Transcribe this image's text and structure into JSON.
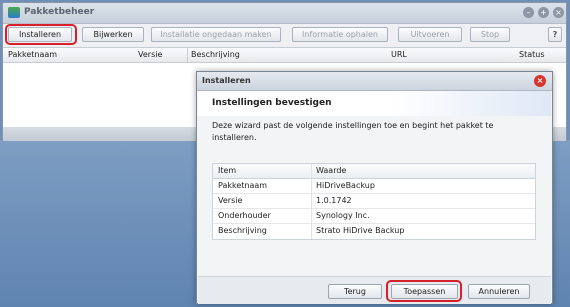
{
  "window": {
    "title": "Pakketbeheer",
    "controls": [
      "minimize-icon",
      "maximize-icon",
      "close-icon"
    ]
  },
  "toolbar": {
    "install_label": "Installeren",
    "update_label": "Bijwerken",
    "undo_install_label": "Installatie ongedaan maken",
    "info_label": "Informatie ophalen",
    "run_label": "Uitvoeren",
    "stop_label": "Stop",
    "help_label": "?"
  },
  "grid": {
    "columns": [
      "Pakketnaam",
      "Versie",
      "Beschrijving",
      "URL",
      "Status"
    ]
  },
  "dialog": {
    "title": "Installeren",
    "heading": "Instellingen bevestigen",
    "description": "Deze wizard past de volgende instellingen toe en begint het pakket te installeren.",
    "table": {
      "headers": [
        "Item",
        "Waarde"
      ],
      "rows": [
        [
          "Pakketnaam",
          "HiDriveBackup"
        ],
        [
          "Versie",
          "1.0.1742"
        ],
        [
          "Onderhouder",
          "Synology Inc."
        ],
        [
          "Beschrijving",
          "Strato HiDrive Backup"
        ]
      ]
    },
    "buttons": {
      "back": "Terug",
      "apply": "Toepassen",
      "cancel": "Annuleren"
    }
  },
  "colors": {
    "highlight": "#d6202a",
    "desktop": "#6d8fb8"
  }
}
